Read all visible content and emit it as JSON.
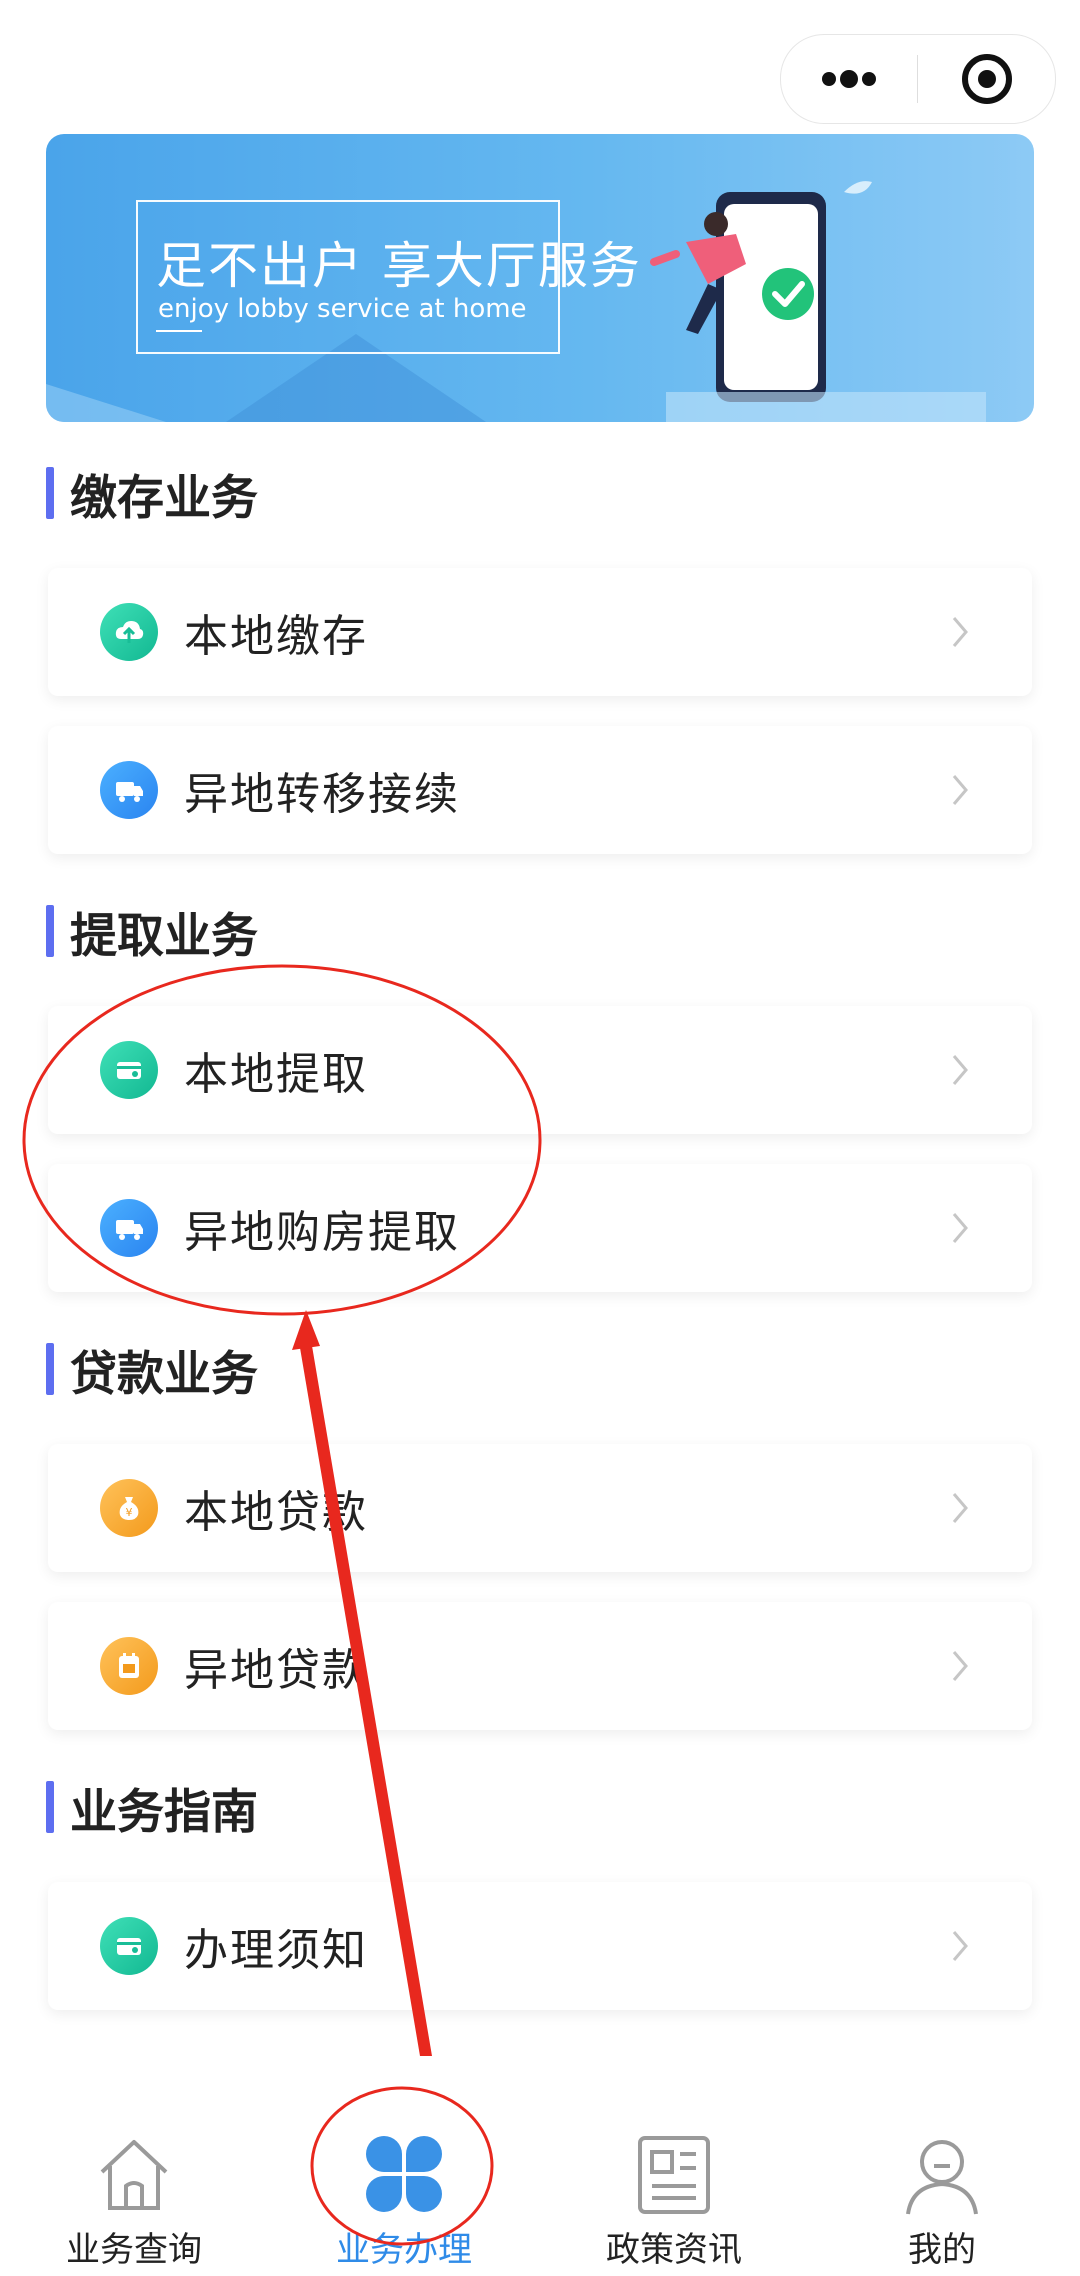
{
  "banner": {
    "title": "足不出户 享大厅服务",
    "subtitle": "enjoy lobby service at home"
  },
  "sections": [
    {
      "title": "缴存业务",
      "items": [
        {
          "label": "本地缴存",
          "icon": "cloud-upload-icon"
        },
        {
          "label": "异地转移接续",
          "icon": "truck-icon"
        }
      ]
    },
    {
      "title": "提取业务",
      "items": [
        {
          "label": "本地提取",
          "icon": "card-icon"
        },
        {
          "label": "异地购房提取",
          "icon": "truck-icon"
        }
      ]
    },
    {
      "title": "贷款业务",
      "items": [
        {
          "label": "本地贷款",
          "icon": "money-bag-icon"
        },
        {
          "label": "异地贷款",
          "icon": "calendar-icon"
        }
      ]
    },
    {
      "title": "业务指南",
      "items": [
        {
          "label": "办理须知",
          "icon": "card-icon"
        }
      ]
    }
  ],
  "tabbar": {
    "tabs": [
      {
        "label": "业务查询",
        "icon": "home-icon",
        "active": false
      },
      {
        "label": "业务办理",
        "icon": "clover-icon",
        "active": true
      },
      {
        "label": "政策资讯",
        "icon": "news-icon",
        "active": false
      },
      {
        "label": "我的",
        "icon": "user-icon",
        "active": false
      }
    ]
  },
  "colors": {
    "accent_bar": "#5d6ef0",
    "tab_active": "#2f8be8",
    "annotation": "#e8281e"
  }
}
